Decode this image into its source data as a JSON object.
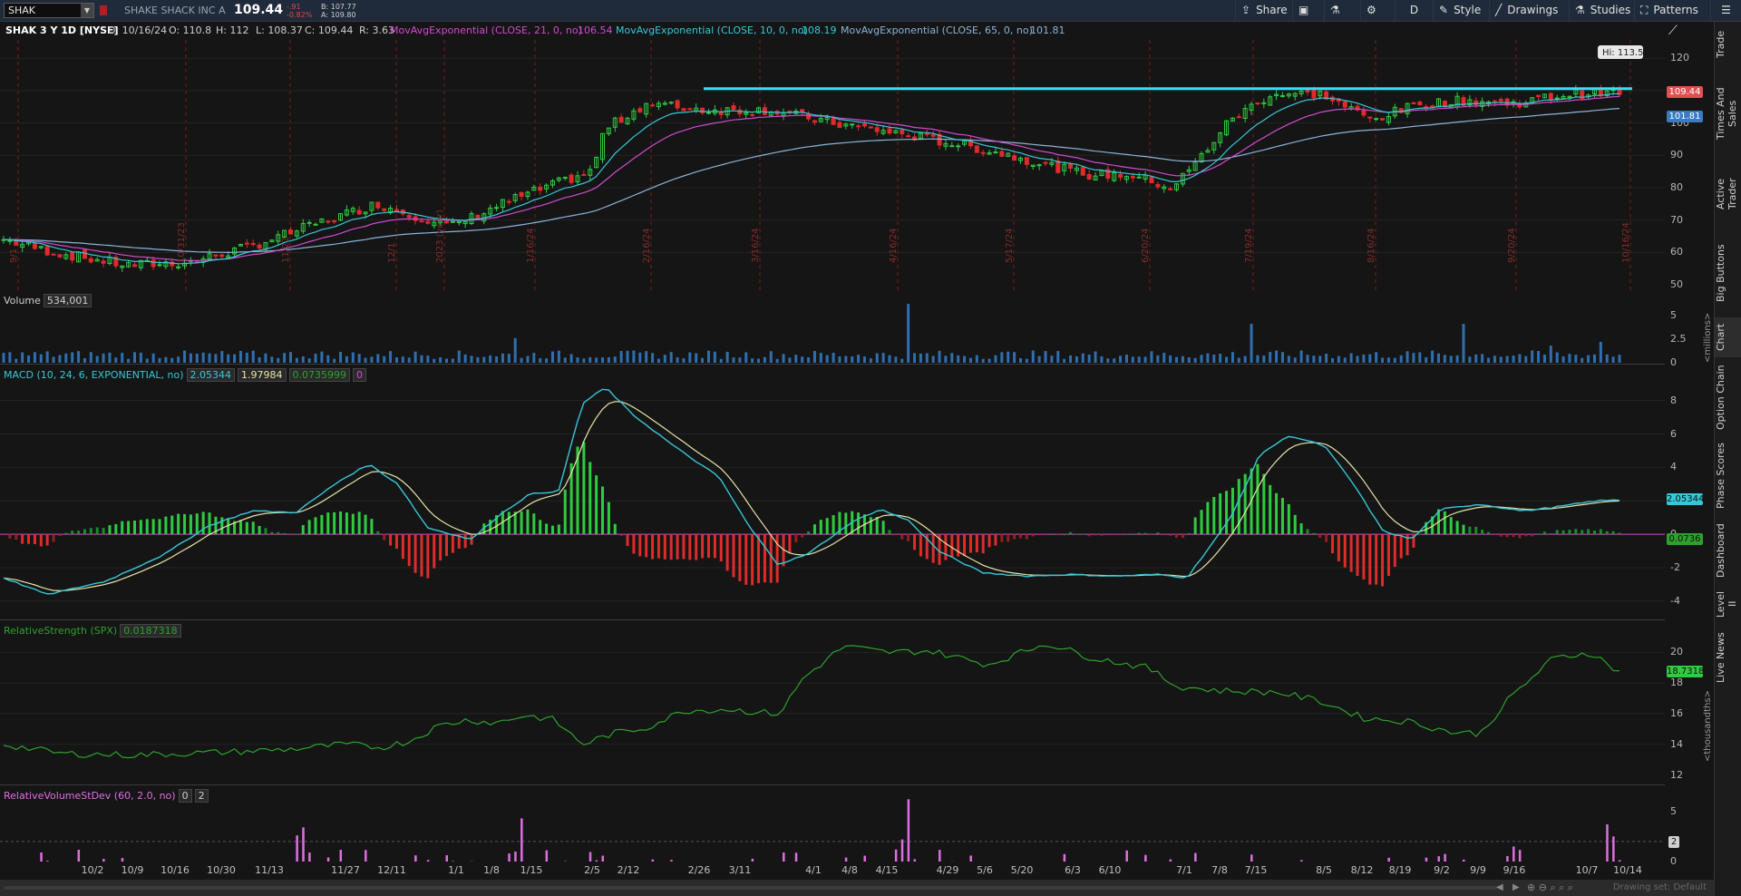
{
  "toolbar": {
    "symbol": "SHAK",
    "company": "SHAKE SHACK INC A",
    "last_price": "109.44",
    "net_change": "-.91",
    "pct_change": "-0.82%",
    "bid": "B: 107.77",
    "ask": "A: 109.80",
    "share_label": "Share",
    "period_label": "D",
    "style_label": "Style",
    "drawings_label": "Drawings",
    "studies_label": "Studies",
    "patterns_label": "Patterns"
  },
  "header": {
    "title": "SHAK 3 Y 1D [NYSE]",
    "date": "D: 10/16/24",
    "open": "O: 110.8",
    "high": "H: 112",
    "low": "L: 108.37",
    "close": "C: 109.44",
    "range": "R: 3.63",
    "ema21_label": "MovAvgExponential (CLOSE, 21, 0, no)",
    "ema21_value": "106.54",
    "ema10_label": "MovAvgExponential (CLOSE, 10, 0, no)",
    "ema10_value": "108.19",
    "ema65_label": "MovAvgExponential (CLOSE, 65, 0, no)",
    "ema65_value": "101.81"
  },
  "price_panel": {
    "ticks": [
      "120",
      "110",
      "100",
      "90",
      "80",
      "70",
      "60",
      "50"
    ],
    "hi_label": "Hi: 113.5",
    "last_tag": "109.44",
    "ema_tag": "101.81",
    "vlines": [
      "9/1",
      "10/31/23",
      "11/22",
      "12/1",
      "2023 (year)",
      "1/16/24",
      "2/16/24",
      "3/16/24",
      "4/16/24",
      "5/17/24",
      "6/20/24",
      "7/19/24",
      "8/16/24",
      "9/20/24",
      "10/16/24"
    ]
  },
  "volume_panel": {
    "label": "Volume",
    "value": "534,001",
    "ticks": [
      "5",
      "2.5",
      "0"
    ],
    "units": "<millions>"
  },
  "macd_panel": {
    "label": "MACD (10, 24, 6, EXPONENTIAL, no)",
    "value": "2.05344",
    "avg": "1.97984",
    "diff": "0.0735999",
    "zero": "0",
    "ticks": [
      "8",
      "6",
      "4",
      "2",
      "0",
      "-2",
      "-4"
    ],
    "value_tag": "2.05344",
    "diff_tag": "0.0736"
  },
  "rs_panel": {
    "label": "RelativeStrength (SPX)",
    "value": "0.0187318",
    "ticks": [
      "20",
      "18",
      "16",
      "14",
      "12"
    ],
    "tag": "18.7318",
    "units": "<thousandths>"
  },
  "rv_panel": {
    "label": "RelativeVolumeStDev (60, 2.0, no)",
    "v1": "0",
    "v2": "2",
    "ticks": [
      "5",
      "2",
      "0"
    ],
    "tag": "2"
  },
  "time_axis": [
    "10/2",
    "10/9",
    "10/16",
    "10/30",
    "11/13",
    "11/27",
    "12/11",
    "1/1",
    "1/8",
    "1/15",
    "2/5",
    "2/12",
    "2/26",
    "3/11",
    "4/1",
    "4/8",
    "4/15",
    "4/29",
    "5/6",
    "5/20",
    "6/3",
    "6/10",
    "7/1",
    "7/8",
    "7/15",
    "8/5",
    "8/12",
    "8/19",
    "9/2",
    "9/9",
    "9/16",
    "10/7",
    "10/14"
  ],
  "sidebar": [
    "Trade",
    "Times And Sales",
    "Active Trader",
    "Big Buttons",
    "Chart",
    "Option Chain",
    "Phase Scores",
    "Dashboard",
    "Level II",
    "Live News"
  ],
  "footer": {
    "drawing_set": "Drawing set: Default"
  },
  "colors": {
    "up": "#2ecc40",
    "down": "#e02b2b",
    "ema10": "#36c8d8",
    "ema21": "#d04bd0",
    "ema65": "#8ab4d8",
    "hline": "#35e0f0",
    "macd": "#36c8d8",
    "macd_avg": "#e8e2a8",
    "rs": "#2ea02e",
    "rv": "#e06ee0"
  }
}
